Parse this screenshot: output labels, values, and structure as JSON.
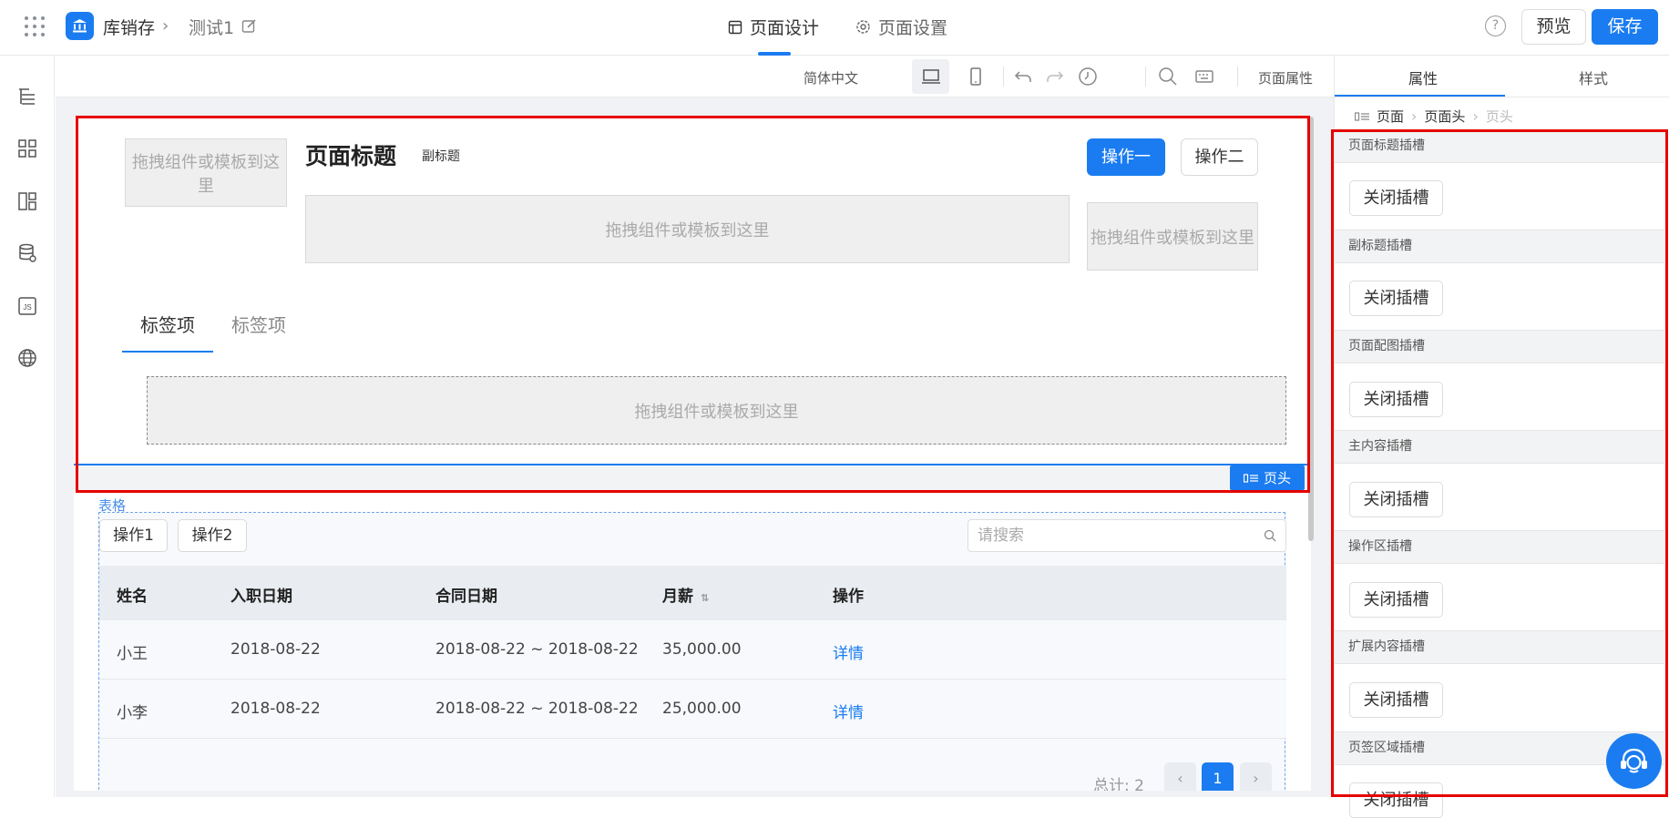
{
  "topbar": {
    "app_name": "库销存",
    "page_name": "测试1",
    "tabs": [
      {
        "label": "页面设计"
      },
      {
        "label": "页面设置"
      }
    ],
    "help": "?",
    "preview_label": "预览",
    "save_label": "保存"
  },
  "toolbar": {
    "language": "简体中文",
    "page_attr": "页面属性"
  },
  "header": {
    "slot_placeholder": "拖拽组件或模板到这里",
    "page_title": "页面标题",
    "subtitle": "副标题",
    "op1": "操作一",
    "op2": "操作二",
    "tabs": [
      {
        "label": "标签项"
      },
      {
        "label": "标签项"
      }
    ],
    "tag": "页头"
  },
  "table": {
    "label": "表格",
    "buttons": [
      "操作1",
      "操作2"
    ],
    "search_placeholder": "请搜索",
    "columns": [
      "姓名",
      "入职日期",
      "合同日期",
      "月薪",
      "操作"
    ],
    "rows": [
      {
        "name": "小王",
        "join": "2018-08-22",
        "contract": "2018-08-22 ~ 2018-08-22",
        "salary": "35,000.00",
        "action": "详情"
      },
      {
        "name": "小李",
        "join": "2018-08-22",
        "contract": "2018-08-22 ~ 2018-08-22",
        "salary": "25,000.00",
        "action": "详情"
      }
    ],
    "pager_total": "总计: 2",
    "pager_current": "1"
  },
  "rightpanel": {
    "tabs": [
      {
        "label": "属性"
      },
      {
        "label": "样式"
      }
    ],
    "breadcrumb": [
      "页面",
      "页面头",
      "页头"
    ],
    "sections": [
      {
        "title": "页面标题插槽",
        "button": "关闭插槽"
      },
      {
        "title": "副标题插槽",
        "button": "关闭插槽"
      },
      {
        "title": "页面配图插槽",
        "button": "关闭插槽"
      },
      {
        "title": "主内容插槽",
        "button": "关闭插槽"
      },
      {
        "title": "操作区插槽",
        "button": "关闭插槽"
      },
      {
        "title": "扩展内容插槽",
        "button": "关闭插槽"
      },
      {
        "title": "页签区域插槽",
        "button": "关闭插槽"
      }
    ]
  },
  "colors": {
    "accent": "#1a7cf0",
    "highlight": "#e60000"
  }
}
